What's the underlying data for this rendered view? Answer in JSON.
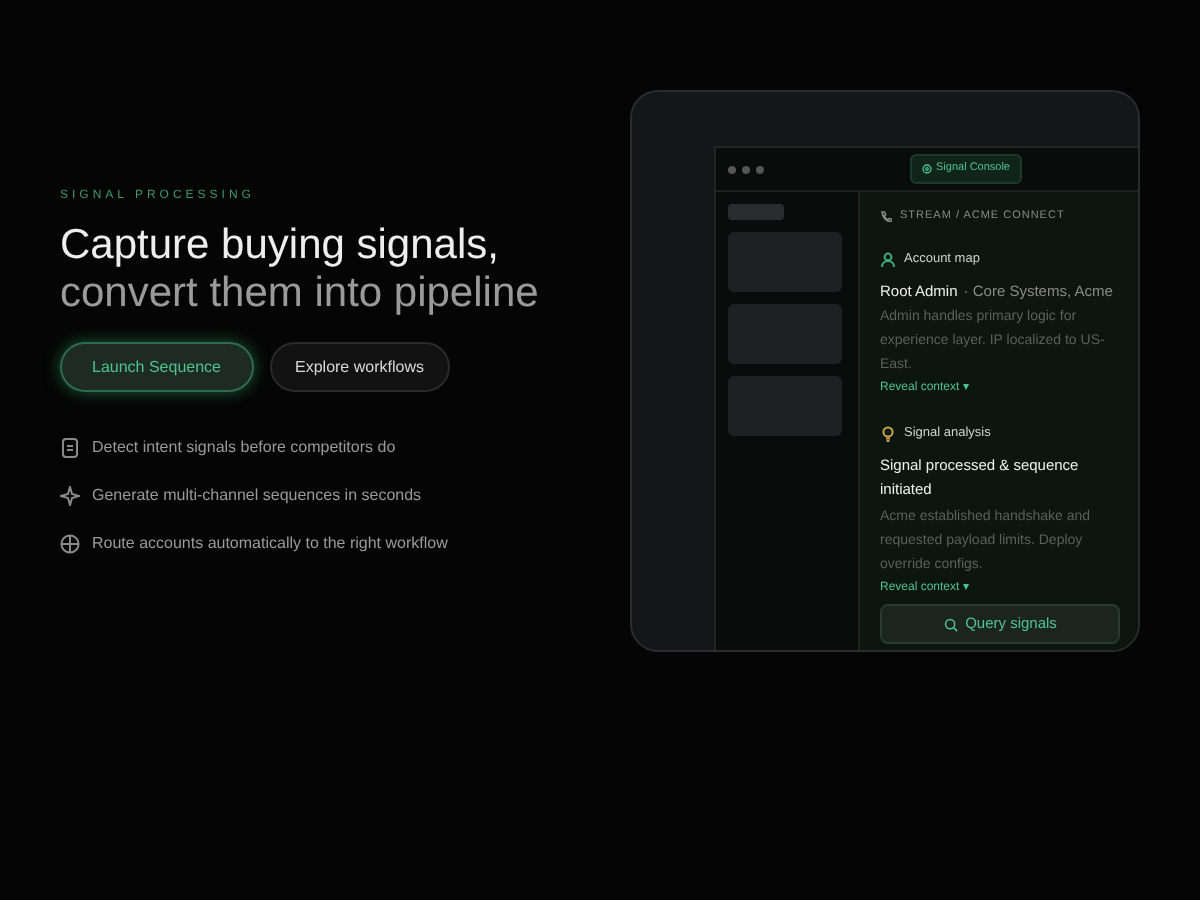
{
  "hero": {
    "eyebrow": "SIGNAL PROCESSING",
    "headline": "Capture buying signals,",
    "subheadline": "convert them into pipeline"
  },
  "buttons": [
    {
      "label": "Launch Sequence",
      "kind": "primary"
    },
    {
      "label": "Explore workflows",
      "kind": "secondary"
    }
  ],
  "features": [
    {
      "text": "Detect intent signals before competitors do",
      "kind": "document"
    },
    {
      "text": "Generate multi-channel sequences in seconds",
      "kind": "sparkle"
    },
    {
      "text": "Route accounts automatically to the right workflow",
      "kind": "target"
    }
  ],
  "console": {
    "badge": "Signal Console",
    "breadcrumb": "STREAM / ACME CONNECT",
    "sections": [
      {
        "kind": "account",
        "title": "Account map",
        "heading": "Root Admin",
        "detail": "· Core Systems, Acme",
        "body": "Admin handles primary logic for experience layer. IP localized to US-East.",
        "link": "Reveal context ▾"
      },
      {
        "kind": "bulb",
        "title": "Signal analysis",
        "heading": "Signal processed & sequence initiated",
        "body": "Acme established handshake and requested payload limits. Deploy override configs.",
        "link": "Reveal context ▾"
      }
    ],
    "action": "Query signals"
  }
}
